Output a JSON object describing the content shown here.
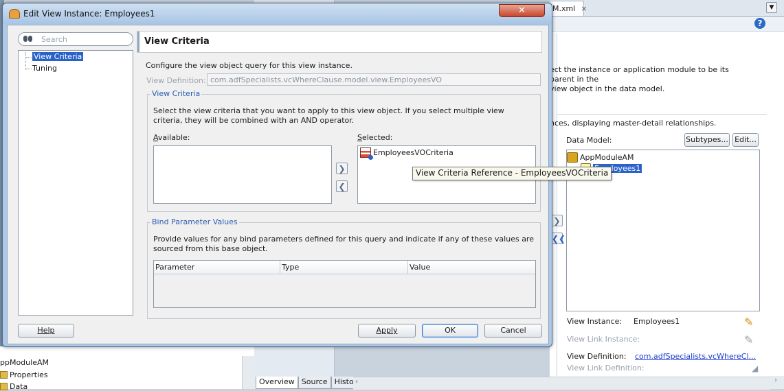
{
  "dialog": {
    "title": "Edit View Instance: Employees1",
    "search_placeholder": "Search",
    "nav_items": [
      "View Criteria",
      "Tuning"
    ],
    "selected_nav": "View Criteria",
    "pane_title": "View Criteria",
    "description": "Configure the view object query for this view instance.",
    "view_definition_label": "View Definition:",
    "view_definition_value": "com.adfSpecialists.vcWhereClause.model.view.EmployeesVO",
    "view_criteria_group": {
      "title": "View Criteria",
      "description": "Select the view criteria that you want to apply to this view object. If you select multiple view criteria, they will be combined with an AND operator.",
      "available_label": "Available:",
      "selected_label": "Selected:",
      "available_items": [],
      "selected_items": [
        "EmployeesVOCriteria"
      ],
      "move_right": "❯",
      "move_left": "❮"
    },
    "bind_group": {
      "title": "Bind Parameter Values",
      "description": "Provide values for any bind parameters defined for this query and indicate if any of these values are sourced from this base object.",
      "columns": [
        "Parameter",
        "Type",
        "Value"
      ],
      "rows": []
    },
    "buttons": {
      "help": "Help",
      "apply": "Apply",
      "ok": "OK",
      "cancel": "Cancel"
    },
    "close_glyph": "✕"
  },
  "tooltip": "View Criteria Reference - EmployeesVOCriteria",
  "ide": {
    "tab_label": "M.xml",
    "tab_close": "×",
    "help_glyph": "?",
    "menu_glyph": "▼",
    "text_line1": "ect the instance or application module to be its parent in the",
    "text_line2": "view object in the data model.",
    "text_line3": "nces, displaying master-detail relationships.",
    "data_model_label": "Data Model:",
    "subtypes_button": "Subtypes...",
    "edit_button": "Edit...",
    "tree_root": "AppModuleAM",
    "tree_child": "Employees1",
    "shuttle_right": "❯",
    "shuttle_left": "❮❮",
    "view_instance_label": "View Instance:",
    "view_instance_value": "Employees1",
    "view_link_instance_label": "View Link Instance:",
    "view_definition_label": "View Definition:",
    "view_definition_link": "com.adfSpecialists.vcWhereCl...",
    "view_link_definition_label": "View Link Definition:",
    "bottom_tabs": [
      "Overview",
      "Source",
      "History"
    ],
    "left_panel_items": [
      "ppModuleAM",
      "Properties",
      "Data"
    ]
  }
}
